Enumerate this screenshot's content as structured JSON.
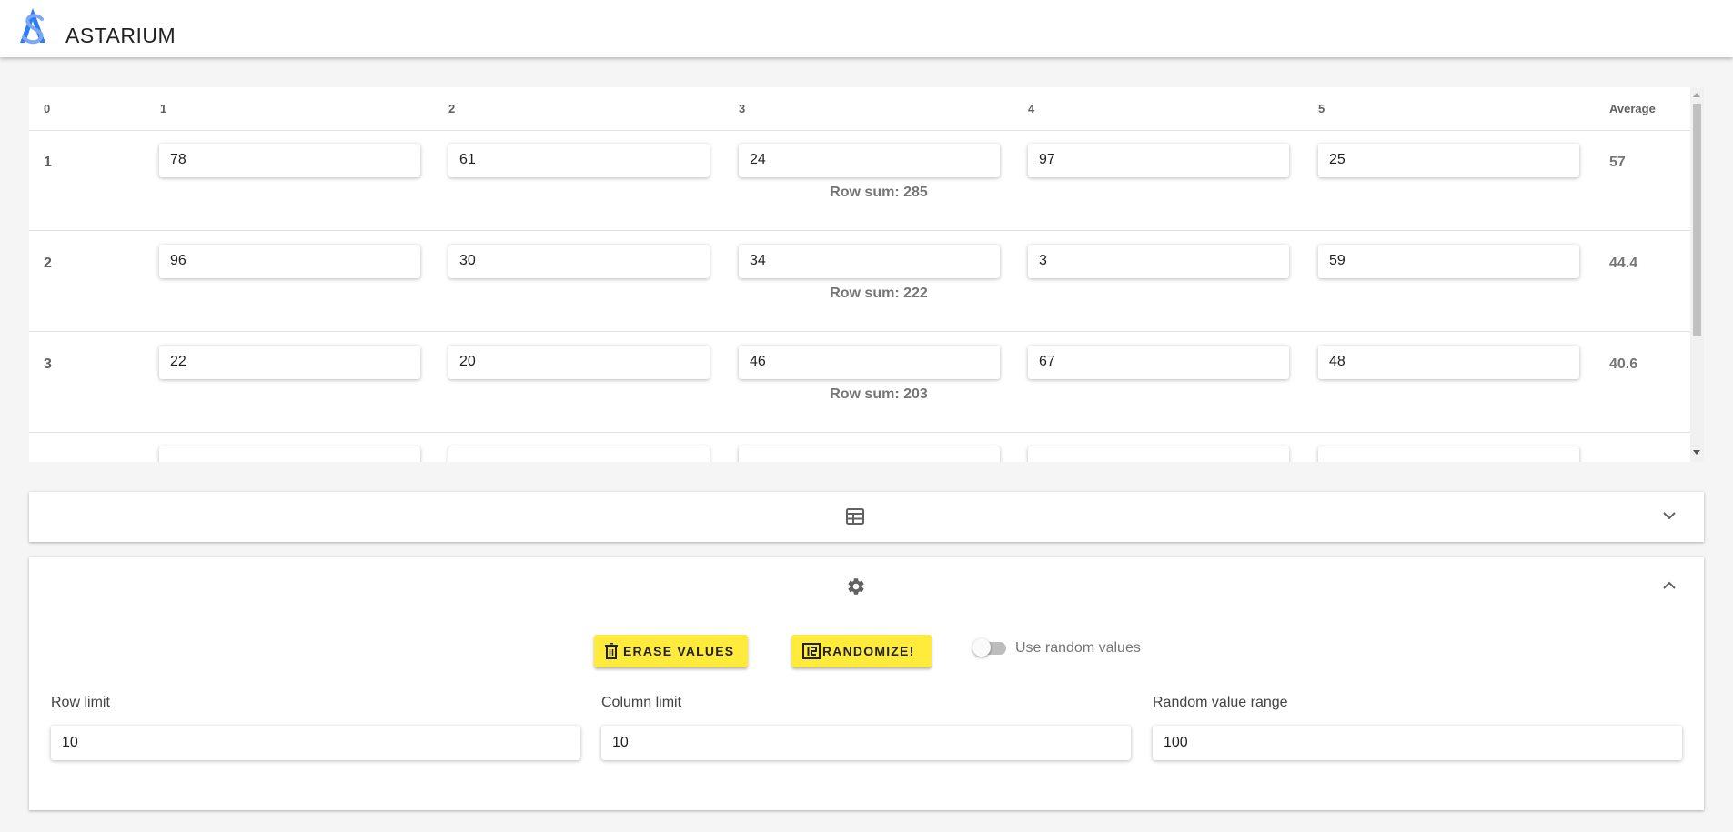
{
  "app": {
    "title": "ASTARIUM"
  },
  "table": {
    "headers": [
      "0",
      "1",
      "2",
      "3",
      "4",
      "5",
      "Average"
    ],
    "rows": [
      {
        "index": "1",
        "values": [
          "78",
          "61",
          "24",
          "97",
          "25"
        ],
        "average": "57",
        "row_sum": "Row sum: 285"
      },
      {
        "index": "2",
        "values": [
          "96",
          "30",
          "34",
          "3",
          "59"
        ],
        "average": "44.4",
        "row_sum": "Row sum: 222"
      },
      {
        "index": "3",
        "values": [
          "22",
          "20",
          "46",
          "67",
          "48"
        ],
        "average": "40.6",
        "row_sum": "Row sum: 203"
      }
    ]
  },
  "panels": {
    "table_panel": {
      "icon": "table-icon",
      "chevron": "chevron-down-icon"
    },
    "settings_panel": {
      "icon": "gear-icon",
      "chevron": "chevron-up-icon",
      "erase_label": "ERASE VALUES",
      "randomize_label": "RANDOMIZE!",
      "switch_label": "Use random values",
      "switch_on": false,
      "fields": [
        {
          "label": "Row limit",
          "value": "10"
        },
        {
          "label": "Column limit",
          "value": "10"
        },
        {
          "label": "Random value range",
          "value": "100"
        }
      ]
    }
  },
  "colors": {
    "accent": "#ffeb3b",
    "logo": "#2f7cf6"
  }
}
